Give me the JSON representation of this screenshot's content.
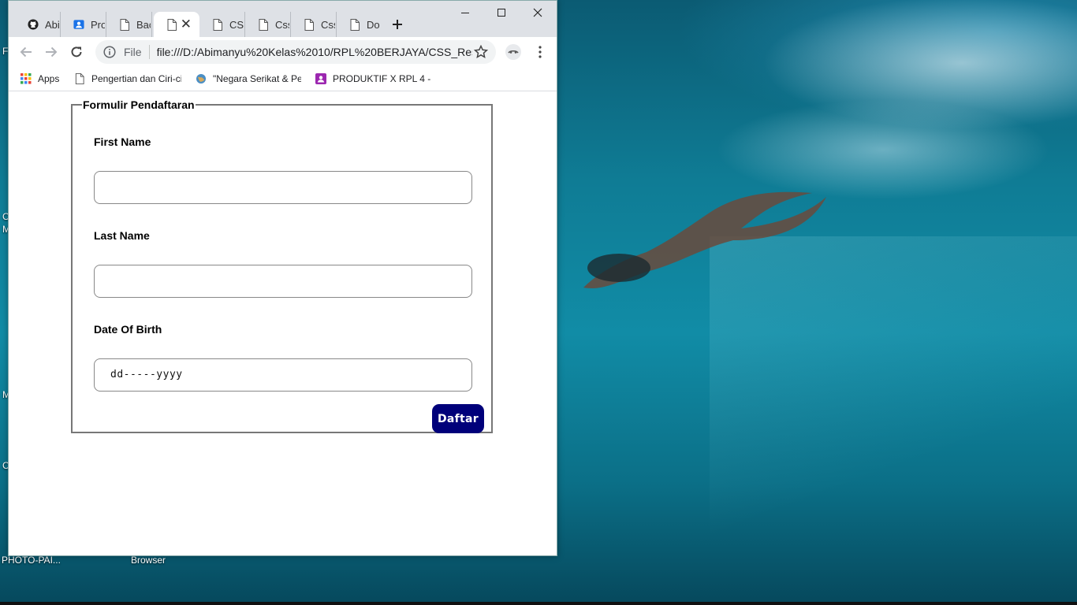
{
  "desktop": {
    "icons": [
      {
        "label": "PHOTO-PAI..."
      },
      {
        "label": "Browser"
      }
    ],
    "edge_letters": [
      "C",
      "M",
      "M",
      "C",
      "F"
    ]
  },
  "browser": {
    "tabs": [
      {
        "title": "Abi",
        "icon": "github-icon"
      },
      {
        "title": "Pro",
        "icon": "profile-icon"
      },
      {
        "title": "Bac",
        "icon": "page-icon"
      },
      {
        "title": "",
        "icon": "page-icon",
        "active": true
      },
      {
        "title": "CSS",
        "icon": "page-icon"
      },
      {
        "title": "Css",
        "icon": "page-icon"
      },
      {
        "title": "Css",
        "icon": "page-icon"
      },
      {
        "title": "Do",
        "icon": "page-icon"
      }
    ],
    "omnibox": {
      "scheme": "File",
      "url": "file:///D:/Abimanyu%20Kelas%2010/RPL%20BERJAYA/CSS_Res..."
    },
    "bookmarks": [
      {
        "label": "Apps",
        "icon": "apps-grid-icon"
      },
      {
        "label": "Pengertian dan Ciri-ci",
        "icon": "page-icon"
      },
      {
        "label": "\"Negara Serikat & Pe",
        "icon": "globe-icon"
      },
      {
        "label": "PRODUKTIF X RPL 4 -",
        "icon": "classroom-icon"
      }
    ]
  },
  "form": {
    "legend": "Formulir Pendaftaran",
    "fields": {
      "first_name": {
        "label": "First Name",
        "value": ""
      },
      "last_name": {
        "label": "Last Name",
        "value": ""
      },
      "dob": {
        "label": "Date Of Birth",
        "placeholder": "dd-----yyyy"
      }
    },
    "submit_label": "Daftar",
    "submit_color": "#00007a"
  }
}
